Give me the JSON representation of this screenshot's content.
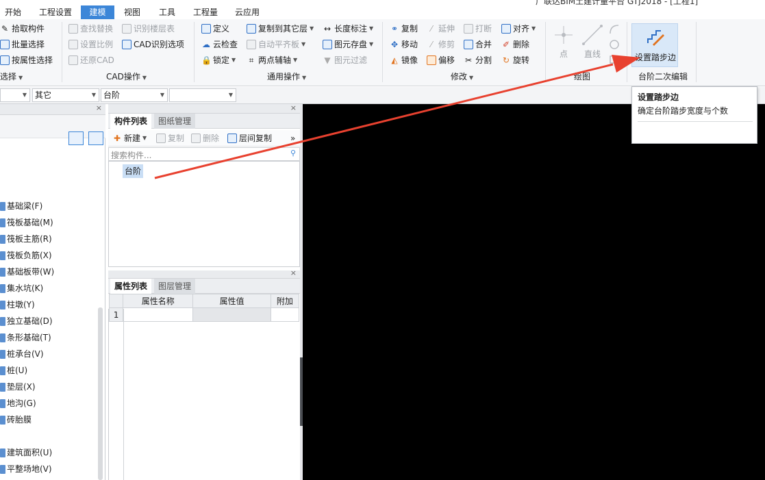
{
  "title_partial": "广联达BIM土建计量平台 GTJ2018 - [工程1]",
  "menu": [
    "开始",
    "工程设置",
    "建模",
    "视图",
    "工具",
    "工程量",
    "云应用"
  ],
  "ribbon": {
    "select": {
      "pick": "拾取构件",
      "batch": "批量选择",
      "by_attr": "按属性选择",
      "group": "选择"
    },
    "cad": {
      "find_replace": "查找替换",
      "detect_floor": "识别楼层表",
      "set_scale": "设置比例",
      "cad_options": "CAD识别选项",
      "restore_cad": "还原CAD",
      "group": "CAD操作"
    },
    "common": {
      "define": "定义",
      "copy_to_floor": "复制到其它层",
      "length_mark": "长度标注",
      "cloud_check": "云检查",
      "auto_align_slab": "自动平齐板",
      "save_elem": "图元存盘",
      "lock": "锁定",
      "two_point_axis": "两点辅轴",
      "elem_filter": "图元过滤",
      "group": "通用操作"
    },
    "modify": {
      "copy": "复制",
      "extend": "延伸",
      "break": "打断",
      "align": "对齐",
      "move": "移动",
      "trim": "修剪",
      "merge": "合并",
      "delete": "删除",
      "mirror": "镜像",
      "offset": "偏移",
      "split": "分割",
      "rotate": "旋转",
      "group": "修改"
    },
    "draw": {
      "point": "点",
      "line": "直线",
      "group": "绘图"
    },
    "step": {
      "set_step_edge": "设置踏步边",
      "group": "台阶二次编辑"
    }
  },
  "filters": [
    "",
    "其它",
    "台阶",
    ""
  ],
  "nav_items": [
    "基础梁(F)",
    "筏板基础(M)",
    "筏板主筋(R)",
    "筏板负筋(X)",
    "基础板带(W)",
    "集水坑(K)",
    "柱墩(Y)",
    "独立基础(D)",
    "条形基础(T)",
    "桩承台(V)",
    "桩(U)",
    "垫层(X)",
    "地沟(G)",
    "砖胎膜",
    "",
    "建筑面积(U)",
    "平整场地(V)"
  ],
  "component_panel": {
    "tab_active": "构件列表",
    "tab_inactive": "图纸管理",
    "new": "新建",
    "copy": "复制",
    "delete": "删除",
    "floor_copy": "层间复制",
    "search_placeholder": "搜索构件...",
    "items": [
      "台阶"
    ]
  },
  "property_panel": {
    "tab_active": "属性列表",
    "tab_inactive": "图层管理",
    "columns": [
      "",
      "属性名称",
      "属性值",
      "附加"
    ],
    "rows": [
      [
        "1",
        "",
        "",
        ""
      ]
    ]
  },
  "tooltip": {
    "title": "设置踏步边",
    "desc": "确定台阶踏步宽度与个数"
  },
  "colors": {
    "accent": "#3c86d8",
    "arrow": "#e8412f",
    "canvas": "#000000"
  },
  "close_glyph": "×",
  "more_glyph": "»"
}
